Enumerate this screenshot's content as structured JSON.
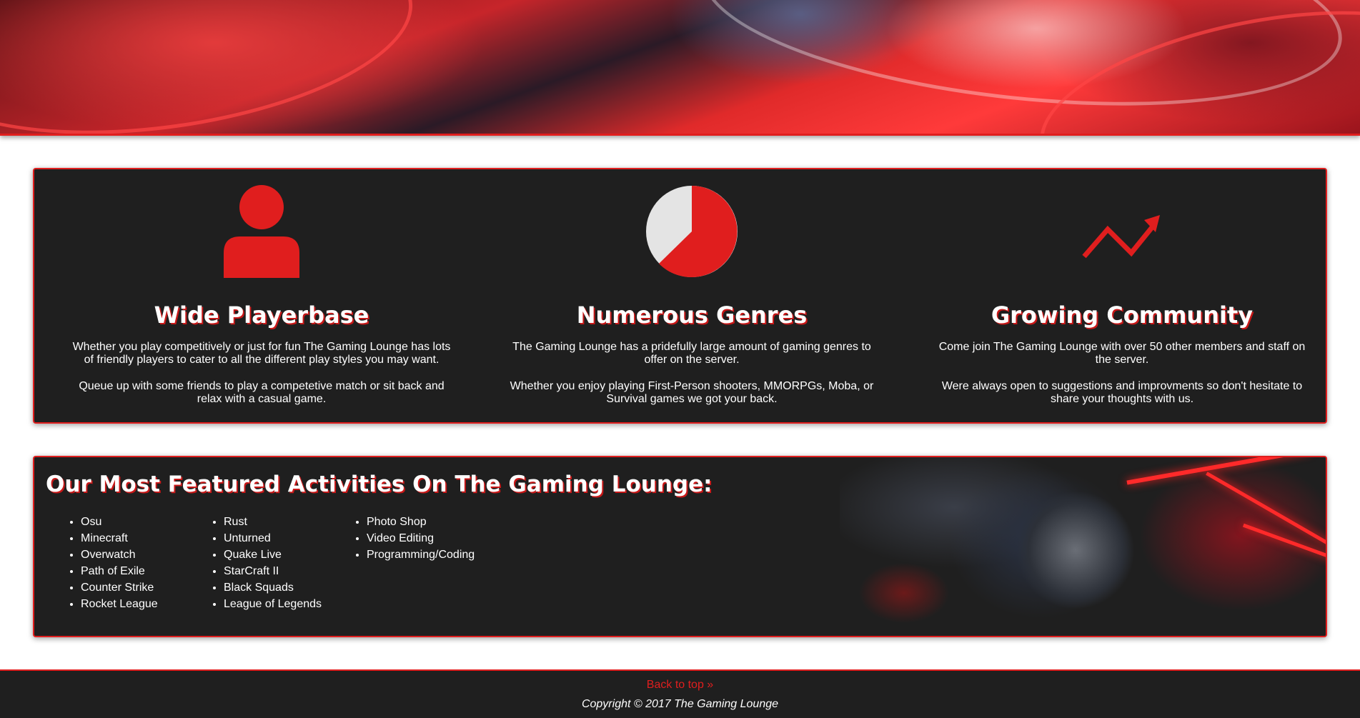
{
  "features": [
    {
      "icon": "user-icon",
      "title": "Wide Playerbase",
      "p1": "Whether you play competitively or just for fun The Gaming Lounge has lots of friendly players to cater to all the different play styles you may want.",
      "p2": "Queue up with some friends to play a competetive match or sit back and relax with a casual game."
    },
    {
      "icon": "pie-chart-icon",
      "title": "Numerous Genres",
      "p1": "The Gaming Lounge has a pridefully large amount of gaming genres to offer on the server.",
      "p2": "Whether you enjoy playing First-Person shooters, MMORPGs, Moba, or Survival games we got your back."
    },
    {
      "icon": "trending-up-icon",
      "title": "Growing Community",
      "p1": "Come join The Gaming Lounge with over 50 other members and staff on the server.",
      "p2": "Were always open to suggestions and improvments so don't hesitate to share your thoughts with us."
    }
  ],
  "activities": {
    "title": "Our Most Featured Activities On The Gaming Lounge:",
    "columns": [
      [
        "Osu",
        "Minecraft",
        "Overwatch",
        "Path of Exile",
        "Counter Strike",
        "Rocket League"
      ],
      [
        "Rust",
        "Unturned",
        "Quake Live",
        "StarCraft II",
        "Black Squads",
        "League of Legends"
      ],
      [
        "Photo Shop",
        "Video Editing",
        "Programming/Coding"
      ]
    ]
  },
  "footer": {
    "back_to_top": "Back to top »",
    "copyright": "Copyright © 2017 The Gaming Lounge"
  },
  "colors": {
    "accent": "#e01e1e",
    "panel": "#1f1f1f",
    "pie_light": "#e4e4e4"
  }
}
